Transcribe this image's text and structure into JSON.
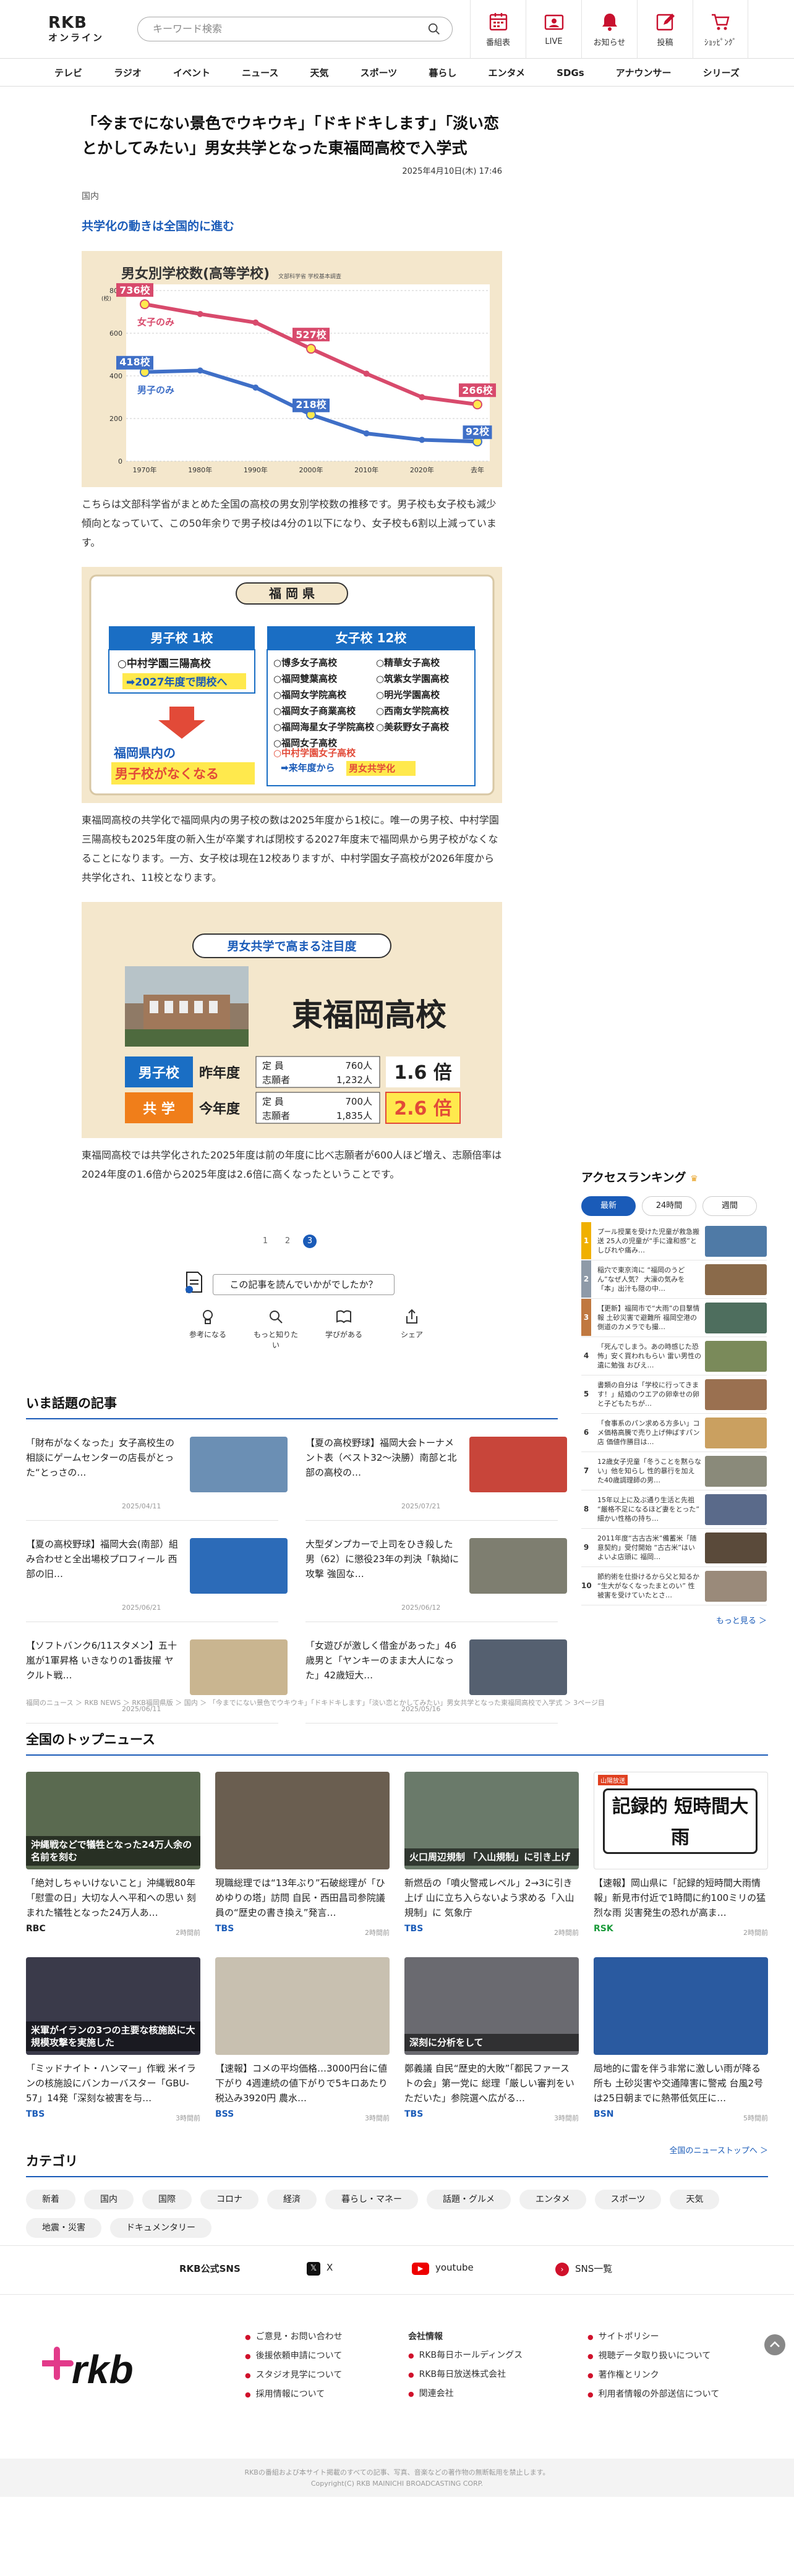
{
  "header": {
    "logo_top": "RKB",
    "logo_bottom": "オンライン",
    "search_placeholder": "キーワード検索",
    "nav": [
      {
        "label": "番組表",
        "icon": "tv-schedule-icon"
      },
      {
        "label": "LIVE",
        "icon": "live-icon"
      },
      {
        "label": "お知らせ",
        "icon": "bell-icon"
      },
      {
        "label": "投稿",
        "icon": "post-icon"
      },
      {
        "label": "ｼｮｯﾋﾟﾝｸﾞ",
        "icon": "cart-icon"
      }
    ]
  },
  "gnav": [
    "テレビ",
    "ラジオ",
    "イベント",
    "ニュース",
    "天気",
    "スポーツ",
    "暮らし",
    "エンタメ",
    "SDGs",
    "アナウンサー",
    "シリーズ"
  ],
  "article": {
    "title": "「今までにない景色でウキウキ」「ドキドキします」「淡い恋とかしてみたい」男女共学となった東福岡高校で入学式",
    "date": "2025年4月10日(木) 17:46",
    "category": "国内",
    "subhead": "共学化の動きは全国的に進む",
    "p1": "こちらは文部科学省がまとめた全国の高校の男女別学校数の推移です。男子校も女子校も減少傾向となっていて、この50年余りで男子校は4分の1以下になり、女子校も6割以上減っています。",
    "p2": "東福岡高校の共学化で福岡県内の男子校の数は2025年度から1校に。唯一の男子校、中村学園三陽高校も2025年度の新入生が卒業すれば閉校する2027年度末で福岡県から男子校がなくなることになります。一方、女子校は現在12校ありますが、中村学園女子高校が2026年度から共学化され、11校となります。",
    "p3": "東福岡高校では共学化された2025年度は前の年度に比べ志願者が600人ほど増え、志願倍率は2024年度の1.6倍から2025年度は2.6倍に高くなったということです。",
    "fig2": {
      "title": "福 岡 県",
      "boys_head": "男子校 1校",
      "girls_head": "女子校 12校",
      "boys_school": "○中村学園三陽高校",
      "boys_note": "➡2027年度で閉校へ",
      "boys_result1": "福岡県内の",
      "boys_result2": "男子校がなくなる",
      "girls": [
        "○博多女子高校",
        "○精華女子高校",
        "○福岡雙葉高校",
        "○筑紫女学園高校",
        "○福岡女学院高校",
        "○明光学園高校",
        "○福岡女子商業高校",
        "○西南女学院高校",
        "○福岡海星女子学院高校",
        "○美萩野女子高校",
        "○福岡女子高校"
      ],
      "girls_last": "○中村学園女子高校",
      "girls_note1": "➡来年度から",
      "girls_note2": "男女共学化"
    },
    "fig3": {
      "title": "男女共学で高まる注目度",
      "school": "東福岡高校",
      "rows": [
        {
          "tag": "男子校",
          "year": "昨年度",
          "l1": "定 員",
          "v1": "760人",
          "l2": "志願者",
          "v2": "1,232人",
          "ratio": "1.6 倍"
        },
        {
          "tag": "共 学",
          "year": "今年度",
          "l1": "定 員",
          "v1": "700人",
          "l2": "志願者",
          "v2": "1,835人",
          "ratio": "2.6 倍"
        }
      ]
    },
    "pages": [
      "1",
      "2",
      "3"
    ],
    "feedback_q": "この記事を読んでいかがでしたか？",
    "feedback": [
      "参考になる",
      "もっと知りたい",
      "学びがある",
      "シェア"
    ]
  },
  "chart_data": {
    "type": "line",
    "title": "男女別学校数(高等学校)",
    "source": "文部科学省 学校基本調査",
    "ylabel": "800\n(校)",
    "categories": [
      "1970年",
      "1980年",
      "1990年",
      "2000年",
      "2010年",
      "2020年",
      "去年"
    ],
    "ylim": [
      0,
      800
    ],
    "yticks": [
      "0",
      "200",
      "400",
      "600",
      "800"
    ],
    "series": [
      {
        "name": "女子の み",
        "label": "女子のみ",
        "values": [
          736,
          690,
          650,
          527,
          410,
          300,
          266
        ],
        "color": "#d84a6c"
      },
      {
        "name": "男子のみ",
        "label": "男子のみ",
        "values": [
          418,
          425,
          345,
          218,
          130,
          100,
          92
        ],
        "color": "#3f6fc7"
      }
    ],
    "data_labels": [
      {
        "series": 0,
        "idx": 0,
        "text": "736校"
      },
      {
        "series": 0,
        "idx": 3,
        "text": "527校"
      },
      {
        "series": 0,
        "idx": 6,
        "text": "266校"
      },
      {
        "series": 1,
        "idx": 0,
        "text": "418校"
      },
      {
        "series": 1,
        "idx": 3,
        "text": "218校"
      },
      {
        "series": 1,
        "idx": 6,
        "text": "92校"
      }
    ]
  },
  "hot": {
    "title": "いま話題の記事",
    "items": [
      {
        "t": "「財布がなくなった」女子高校生の相談にゲームセンターの店長がとった“とっさの…",
        "d": "2025/04/11",
        "c": "#6b8fb4"
      },
      {
        "t": "【夏の高校野球】福岡大会トーナメント表（ベスト32〜決勝）南部と北部の高校の…",
        "d": "2025/07/21",
        "c": "#c8453a"
      },
      {
        "t": "【夏の高校野球】福岡大会(南部）組み合わせと全出場校プロフィール 西部の旧…",
        "d": "2025/06/21",
        "c": "#2c6bb8"
      },
      {
        "t": "大型ダンプカーで上司をひき殺した男（62）に懲役23年の判決「執拗に攻撃 強固な…",
        "d": "2025/06/12",
        "c": "#7e7e70"
      },
      {
        "t": "【ソフトバンク6/11スタメン】五十嵐が1軍昇格 いきなりの1番抜擢 ヤクルト戦…",
        "d": "2025/06/11",
        "c": "#c9b590"
      },
      {
        "t": "「女遊びが激しく借金があった」46歳男と「ヤンキーのまま大人になった」42歳短大…",
        "d": "2025/05/16",
        "c": "#556070"
      }
    ]
  },
  "ranking": {
    "title": "アクセスランキング",
    "tabs": [
      "最新",
      "24時間",
      "週間"
    ],
    "more": "もっと見る ＞",
    "items": [
      {
        "t": "プール授業を受けた児童が救急搬送 25人の児童が“手に違和感”としびれや痛み…",
        "c": "#4f7aa6"
      },
      {
        "t": "稲穴で東京湾に “福岡のうどん”なぜ人気？ 大濠の気みを「本」出汁も隠の中…",
        "c": "#8a6a4a"
      },
      {
        "t": "【更新】福岡市で“大雨”の目撃情報 土砂災害で避難所 福岡空港の側道のカメラでも撮…",
        "c": "#4e6e5e"
      },
      {
        "t": "「死んでしまう。あの時感じた恐怖」安く買われもらい 雷い男性の遺に勉強 おびえ…",
        "c": "#7a8a5a"
      },
      {
        "t": "書類の自分は「学校に行ってきます！」結婚のウエアの卵幸せの卵と子どもたちが…",
        "c": "#9a7050"
      },
      {
        "t": "「食事系のパン求める方多い」コメ価格高騰で売り上げ伸ばすパン店 価値作勝目は…",
        "c": "#caa060"
      },
      {
        "t": "12歳女子児童「冬うことを黙らない」他を知らし 性的暴行を加えた40歳調理師の男…",
        "c": "#8a8a7a"
      },
      {
        "t": "15年以上に及ぶ通り生活と先祖 “厳格不足になるほど妻をとった” 細かい性格の持ち…",
        "c": "#5a6a8a"
      },
      {
        "t": "2011年度“古古古米”備蓄米「随意契約」受付開始 “古古米”はいよいよ店頭に 福岡…",
        "c": "#5a4a3a"
      },
      {
        "t": "節約術を仕掛けるから父と知るか “生大がなくなったまとのい” 性被害を受けていたとさ…",
        "c": "#9a8a7a"
      }
    ]
  },
  "breadcrumb": "福岡のニュース ＞ RKB NEWS ＞ RKB福岡県版 ＞ 国内 ＞ 「今までにない景色でウキウキ」「ドキドキします」「淡い恋とかしてみたい」男女共学となった東福岡高校で入学式 ＞ 3ページ目",
  "top": {
    "title": "全国のトップニュース",
    "more": "全国のニューストップへ ＞",
    "items": [
      {
        "t": "「絶対しちゃいけないこと」沖縄戦80年「慰霊の日」大切な人へ平和への思い 刻まれた犠牲となった24万人あ…",
        "src": "RBC",
        "sc": "#222",
        "dt": "2時間前",
        "c": "#5a6a50",
        "cap": "沖縄戦などで犠牲となった24万人余の名前を刻む"
      },
      {
        "t": "現職総理では“13年ぶり”石破総理が「ひめゆりの塔」訪問 自民・西田昌司参院議員の“歴史の書き換え”発言…",
        "src": "TBS",
        "sc": "#1a5bb8",
        "dt": "2時間前",
        "c": "#6a5e50",
        "cap": ""
      },
      {
        "t": "新燃岳の「噴火警戒レベル」2→3に引き上げ 山に立ち入らないよう求める「入山規制」に 気象庁",
        "src": "TBS",
        "sc": "#1a5bb8",
        "dt": "2時間前",
        "c": "#6a7a6a",
        "cap": "火口周辺規制 「入山規制」に引き上げ"
      },
      {
        "t": "【速報】岡山県に「記録的短時間大雨情報」新見市付近で1時間に約100ミリの猛烈な雨 災害発生の恐れが高ま…",
        "src": "RSK",
        "sc": "#1a9a3a",
        "dt": "2時間前",
        "c": "#ffffff",
        "cap": "記録的 短時間大雨"
      },
      {
        "t": "「ミッドナイト・ハンマー」作戦 米イランの核施設にバンカーバスター「GBU-57」14発「深刻な被害を与…",
        "src": "TBS",
        "sc": "#1a5bb8",
        "dt": "3時間前",
        "c": "#3a3a4a",
        "cap": "米軍がイランの3つの主要な核施設に大規模攻撃を実施した"
      },
      {
        "t": "【速報】コメの平均価格…3000円台に値下がり 4週連続の値下がりで5キロあたり税込み3920円 農水…",
        "src": "BSS",
        "sc": "#1a5bb8",
        "dt": "3時間前",
        "c": "#c8c0b0",
        "cap": ""
      },
      {
        "t": "鄭義議 自民“歴史的大敗”「都民ファーストの会」第一党に 総理「厳しい審判をいただいた」参院選へ広がる…",
        "src": "TBS",
        "sc": "#1a5bb8",
        "dt": "3時間前",
        "c": "#6a6a70",
        "cap": "深刻に分析をして"
      },
      {
        "t": "局地的に雷を伴う非常に激しい雨が降る所も 土砂災害や交通障害に警戒 台風2号は25日朝までに熱帯低気圧に…",
        "src": "BSN",
        "sc": "#1a5bb8",
        "dt": "5時間前",
        "c": "#2a5aa0",
        "cap": ""
      }
    ]
  },
  "categories": {
    "title": "カテゴリ",
    "items": [
      "新着",
      "国内",
      "国際",
      "コロナ",
      "経済",
      "暮らし・マネー",
      "話題・グルメ",
      "エンタメ",
      "スポーツ",
      "天気",
      "地震・災害",
      "ドキュメンタリー"
    ]
  },
  "sns": {
    "label": "RKB公式SNS",
    "x": "X",
    "youtube": "youtube",
    "list": "SNS一覧"
  },
  "footer": {
    "logo": "rkb",
    "col1": [
      "ご意見・お問い合わせ",
      "後援依頼申請について",
      "スタジオ見学について",
      "採用情報について"
    ],
    "col2_head": "会社情報",
    "col2": [
      "RKB毎日ホールディングス",
      "RKB毎日放送株式会社",
      "関連会社"
    ],
    "col3": [
      "サイトポリシー",
      "視聴データ取り扱いについて",
      "著作権とリンク",
      "利用者情報の外部送信について"
    ],
    "copy1": "RKBの番組および本サイト掲載のすべての記事、写真、音楽などの著作物の無断転用を禁止します。",
    "copy2": "Copyright(C) RKB MAINICHI BROADCASTING CORP."
  }
}
